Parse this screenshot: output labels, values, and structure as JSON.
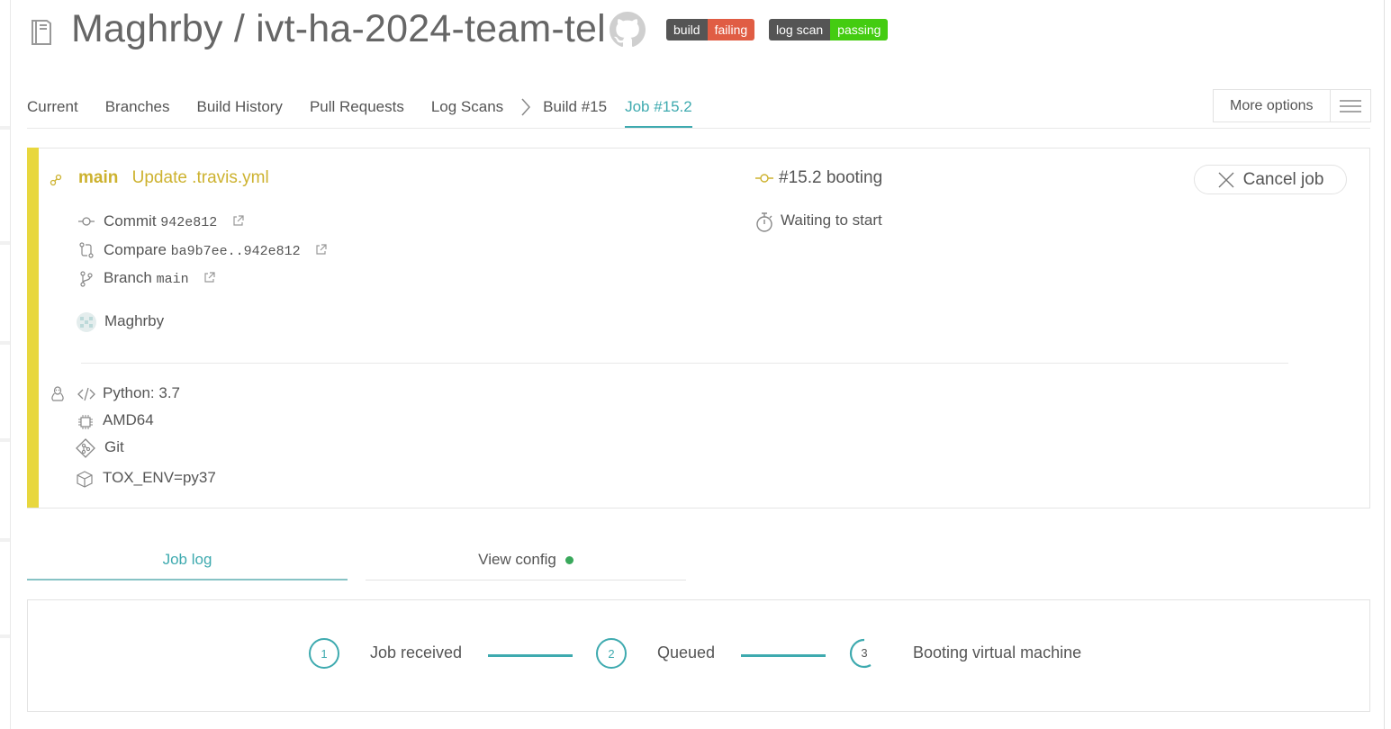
{
  "header": {
    "title": "Maghrby / ivt-ha-2024-team-tel",
    "repo_icon": "repo-book-icon",
    "github_icon": "github-icon",
    "badges": [
      {
        "label": "build",
        "status": "failing",
        "color": "#e05d44"
      },
      {
        "label": "log scan",
        "status": "passing",
        "color": "#44cc11"
      }
    ]
  },
  "nav": {
    "items": [
      "Current",
      "Branches",
      "Build History",
      "Pull Requests",
      "Log Scans"
    ],
    "breadcrumb": "Build #15",
    "active": "Job #15.2",
    "more_options": "More options"
  },
  "job": {
    "branch": "main",
    "message": "Update .travis.yml",
    "commit_label": "Commit",
    "commit": "942e812",
    "compare_label": "Compare",
    "compare": "ba9b7ee..942e812",
    "branch_label": "Branch",
    "branch_value": "main",
    "author": "Maghrby",
    "job_number": "#15.2 booting",
    "waiting": "Waiting to start",
    "cancel": "Cancel job",
    "python": "Python: 3.7",
    "arch": "AMD64",
    "vcs": "Git",
    "env": "TOX_ENV=py37",
    "accent_color": "#e8d73e"
  },
  "tabs": {
    "job_log": "Job log",
    "view_config": "View config"
  },
  "steps": [
    {
      "num": "1",
      "label": "Job received"
    },
    {
      "num": "2",
      "label": "Queued"
    },
    {
      "num": "3",
      "label": "Booting virtual machine"
    }
  ],
  "colors": {
    "teal": "#3eaaaf",
    "text": "#555555"
  }
}
